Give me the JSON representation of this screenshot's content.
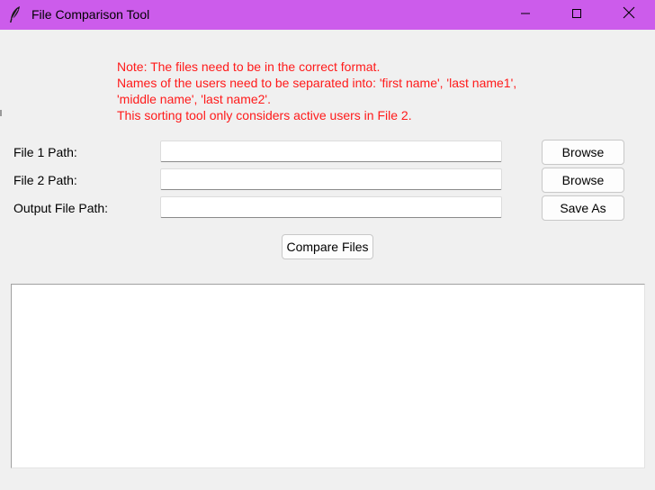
{
  "window": {
    "title": "File Comparison Tool",
    "titlebar_color": "#cc5ceb",
    "controls": {
      "minimize_icon": "minimize-icon",
      "maximize_icon": "maximize-icon",
      "close_icon": "close-icon"
    }
  },
  "note": {
    "color": "#ff1a1a",
    "lines": [
      "Note: The files need to be in the correct format.",
      "Names of the users need to be separated into: 'first name', 'last name1',",
      "'middle name', 'last name2'.",
      "This sorting tool only considers active users in File 2."
    ]
  },
  "form": {
    "file1": {
      "label": "File 1 Path:",
      "value": "",
      "button": "Browse"
    },
    "file2": {
      "label": "File 2 Path:",
      "value": "",
      "button": "Browse"
    },
    "output": {
      "label": "Output File Path:",
      "value": "",
      "button": "Save As"
    }
  },
  "actions": {
    "compare_label": "Compare Files"
  },
  "results": {
    "text": ""
  }
}
